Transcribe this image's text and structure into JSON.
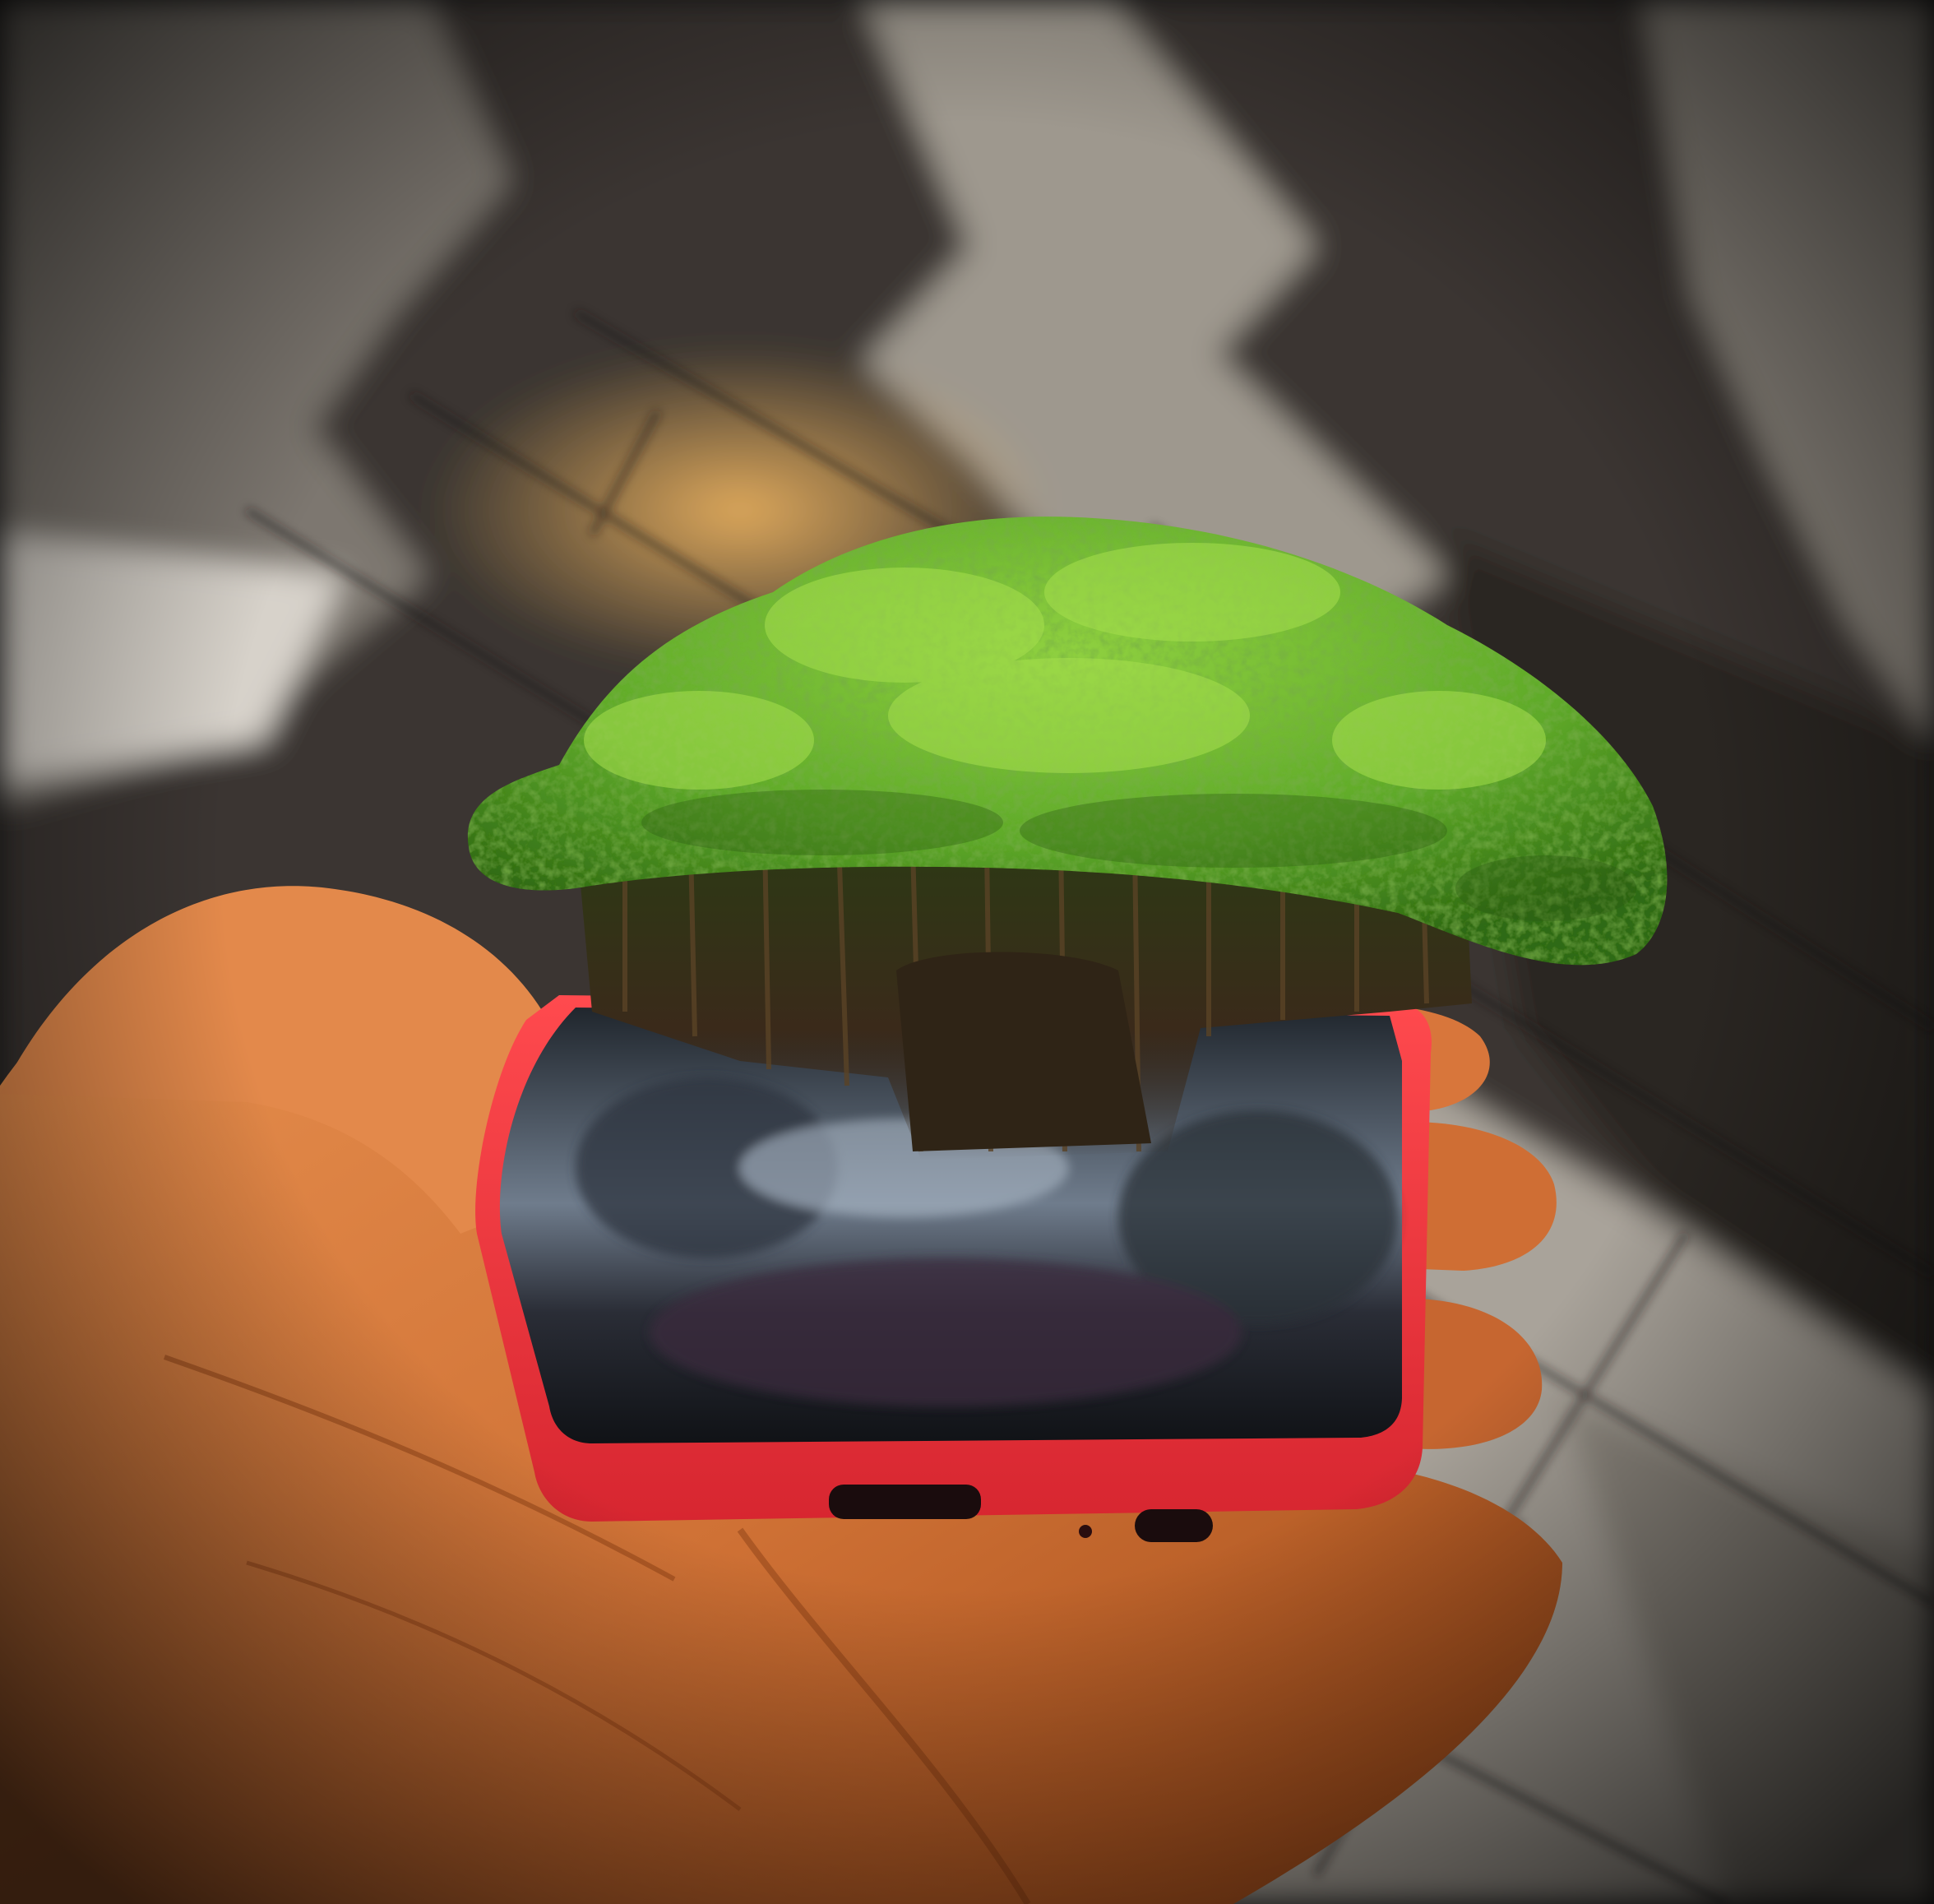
{
  "image": {
    "subject": "hand-holding-phone-with-tree-emerging-from-screen",
    "colors": {
      "paving_dark": "#2e2a26",
      "paving_light": "#b8b2a8",
      "paving_warm": "#c89a55",
      "canopy_green": "#5faa2a",
      "canopy_light": "#8fd040",
      "canopy_dark": "#2f6a14",
      "trunk": "#3a2a1a",
      "phone_case": "#e8333c",
      "screen": "#1b1f24",
      "skin": "#e08a4a",
      "skin_shadow": "#a5501f",
      "vignette": "#0a0a0a"
    }
  }
}
